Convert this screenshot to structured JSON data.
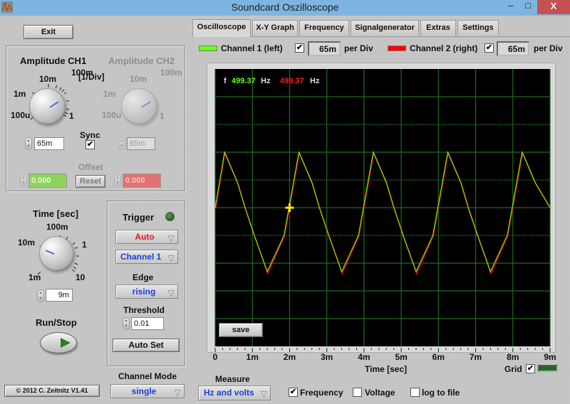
{
  "window": {
    "title": "Soundcard Oszilloscope",
    "minimize": "–",
    "maximize": "□",
    "close": "X"
  },
  "left": {
    "exit_label": "Exit",
    "amplitude": {
      "ch1_title": "Amplitude CH1",
      "ch2_title": "Amplitude CH2",
      "unit_label": "[1/Div]",
      "ticks": [
        "100u",
        "1m",
        "10m",
        "100m",
        "1"
      ],
      "ch1_value": "65m",
      "ch2_value": "65m",
      "sync_label": "Sync",
      "sync_checked": true,
      "offset_label": "Offset",
      "offset_ch1": "0.000",
      "offset_ch2": "0.000",
      "reset_label": "Reset"
    },
    "time": {
      "title": "Time [sec]",
      "ticks": [
        "1m",
        "10m",
        "100m",
        "1",
        "10"
      ],
      "value": "9m"
    },
    "run_stop_label": "Run/Stop",
    "trigger": {
      "title": "Trigger",
      "mode": "Auto",
      "channel": "Channel 1",
      "edge_label": "Edge",
      "edge": "rising",
      "threshold_label": "Threshold",
      "threshold": "0.01",
      "autoset_label": "Auto Set"
    },
    "channel_mode_label": "Channel Mode",
    "channel_mode": "single",
    "copyright": "© 2012  C. Zeitnitz V1.41"
  },
  "tabs": [
    {
      "label": "Oscilloscope",
      "active": true
    },
    {
      "label": "X-Y Graph",
      "active": false
    },
    {
      "label": "Frequency",
      "active": false
    },
    {
      "label": "Signalgenerator",
      "active": false
    },
    {
      "label": "Extras",
      "active": false
    },
    {
      "label": "Settings",
      "active": false
    }
  ],
  "channels": {
    "ch1_label": "Channel 1 (left)",
    "ch1_color": "#66ff1a",
    "ch1_enabled": true,
    "ch1_per_div": "65m",
    "ch2_label": "Channel 2 (right)",
    "ch2_color": "#ff0000",
    "ch2_enabled": true,
    "ch2_per_div": "65m",
    "per_div_label": "per Div"
  },
  "scope": {
    "freq_prefix": "f",
    "freq_ch1": "499.37",
    "freq_ch2": "499.37",
    "freq_unit": "Hz",
    "save_label": "save",
    "x_axis_label": "Time [sec]",
    "grid_label": "Grid",
    "grid_checked": true,
    "grid_color": "#1e6b1e"
  },
  "measure": {
    "label": "Measure",
    "mode": "Hz and volts",
    "frequency_label": "Frequency",
    "frequency_checked": true,
    "voltage_label": "Voltage",
    "voltage_checked": false,
    "log_label": "log to file",
    "log_checked": false
  },
  "chart_data": {
    "type": "line",
    "title": "",
    "xlabel": "Time [sec]",
    "ylabel": "",
    "x_ticks": [
      "0",
      "1m",
      "2m",
      "3m",
      "4m",
      "5m",
      "6m",
      "7m",
      "8m",
      "9m"
    ],
    "xlim": [
      0,
      0.009
    ],
    "ylim": [
      -5,
      5
    ],
    "y_unit": "divisions",
    "grid": true,
    "trigger_marker": {
      "x": 0.002,
      "y": 0
    },
    "series": [
      {
        "name": "Channel 1 (left)",
        "color": "#66ff1a",
        "x": [
          0,
          0.00025,
          0.0006,
          0.0008,
          0.00105,
          0.0014,
          0.00185,
          0.00225,
          0.0026,
          0.0028,
          0.00305,
          0.0034,
          0.00385,
          0.00425,
          0.0046,
          0.0048,
          0.00505,
          0.0054,
          0.00585,
          0.00625,
          0.0066,
          0.0068,
          0.00705,
          0.0074,
          0.00785,
          0.00825,
          0.0086,
          0.009
        ],
        "y": [
          0,
          2.0,
          0.9,
          0.0,
          -1.0,
          -2.3,
          -1.0,
          2.0,
          0.9,
          0.0,
          -1.0,
          -2.3,
          -1.0,
          2.0,
          0.9,
          0.0,
          -1.0,
          -2.3,
          -1.0,
          2.0,
          0.9,
          0.0,
          -1.0,
          -2.3,
          -1.0,
          2.0,
          0.9,
          0.0
        ]
      },
      {
        "name": "Channel 2 (right)",
        "color": "#ff0000",
        "x": [
          0,
          0.00025,
          0.0006,
          0.0008,
          0.00105,
          0.0014,
          0.00185,
          0.00225,
          0.0026,
          0.0028,
          0.00305,
          0.0034,
          0.00385,
          0.00425,
          0.0046,
          0.0048,
          0.00505,
          0.0054,
          0.00585,
          0.00625,
          0.0066,
          0.0068,
          0.00705,
          0.0074,
          0.00785,
          0.00825,
          0.0086,
          0.009
        ],
        "y": [
          0,
          2.0,
          0.9,
          0.0,
          -1.0,
          -2.35,
          -1.0,
          2.0,
          0.9,
          0.0,
          -1.0,
          -2.35,
          -1.0,
          2.0,
          0.9,
          0.0,
          -1.0,
          -2.35,
          -1.0,
          2.0,
          0.9,
          0.0,
          -1.0,
          -2.35,
          -1.0,
          2.0,
          0.9,
          0.0
        ]
      }
    ]
  }
}
